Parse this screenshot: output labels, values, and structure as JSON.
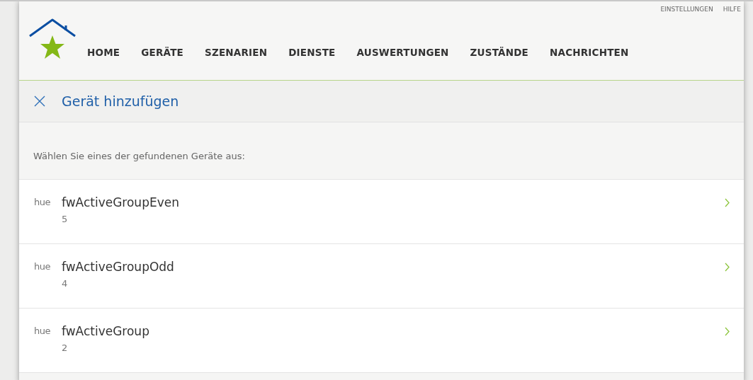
{
  "top_links": [
    "EINSTELLUNGEN",
    "HILFE"
  ],
  "nav": [
    {
      "label": "HOME",
      "selected": false
    },
    {
      "label": "GERÄTE",
      "selected": false
    },
    {
      "label": "SZENARIEN",
      "selected": false
    },
    {
      "label": "DIENSTE",
      "selected": false
    },
    {
      "label": "AUSWERTUNGEN",
      "selected": false
    },
    {
      "label": "ZUSTÄNDE",
      "selected": false
    },
    {
      "label": "NACHRICHTEN",
      "selected": false
    }
  ],
  "dialog": {
    "title": "Gerät hinzufügen",
    "prompt": "Wählen Sie eines der gefundenen Geräte aus:"
  },
  "devices": [
    {
      "brand": "hue",
      "name": "fwActiveGroupEven",
      "count": "5"
    },
    {
      "brand": "hue",
      "name": "fwActiveGroupOdd",
      "count": "4"
    },
    {
      "brand": "hue",
      "name": "fwActiveGroup",
      "count": "2"
    }
  ]
}
